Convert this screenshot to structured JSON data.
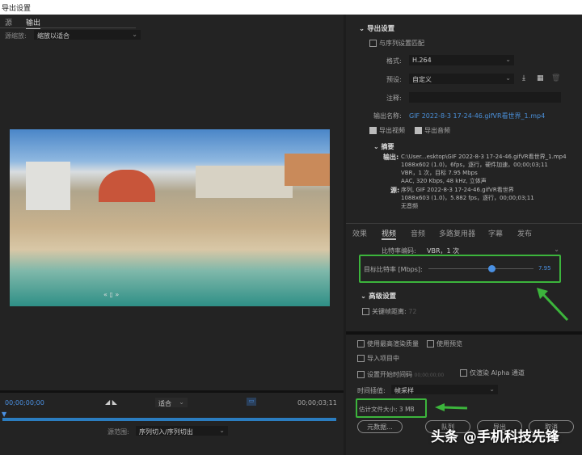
{
  "window": {
    "title": "导出设置"
  },
  "left": {
    "tabs": [
      {
        "label": "源"
      },
      {
        "label": "输出"
      }
    ],
    "source_scale_label": "源缩放:",
    "source_scale_value": "缩放以适合",
    "timecode_start": "00;00;00;00",
    "timecode_end": "00;00;03;11",
    "fit_value": "适合",
    "source_range_label": "源范围:",
    "source_range_value": "序列切入/序列切出",
    "carousel_nav": "«  ▯  »"
  },
  "export_settings": {
    "section_title": "导出设置",
    "match_sequence": "与序列设置匹配",
    "format_label": "格式:",
    "format_value": "H.264",
    "preset_label": "预设:",
    "preset_value": "自定义",
    "comment_label": "注释:",
    "comment_value": "",
    "output_name_label": "输出名称:",
    "output_name_value": "GIF 2022-8-3 17-24-46.gifVR看世界_1.mp4",
    "export_video": "导出视频",
    "export_audio": "导出音频",
    "summary_title": "摘要",
    "output_label": "输出:",
    "output_lines": [
      "C:\\User...esktop\\GIF 2022-8-3 17-24-46.gifVR看世界_1.mp4",
      "1088x602 (1.0)，6fps，逐行，硬件加速，00;00;03;11",
      "VBR，1 次，目标 7.95 Mbps",
      "AAC, 320 Kbps, 48 kHz, 立体声"
    ],
    "source_label": "源:",
    "source_lines": [
      "序列, GIF 2022-8-3 17-24-46.gifVR看世界",
      "1088x603 (1.0)，5.882 fps，逐行，00;00;03;11",
      "无音频"
    ]
  },
  "settings_tabs": [
    {
      "label": "效果"
    },
    {
      "label": "视频"
    },
    {
      "label": "音频"
    },
    {
      "label": "多路复用器"
    },
    {
      "label": "字幕"
    },
    {
      "label": "发布"
    }
  ],
  "video": {
    "bitrate_encoding_label": "比特率编码:",
    "bitrate_encoding_value": "VBR，1 次",
    "target_bitrate_label": "目标比特率 [Mbps]:",
    "target_bitrate_value": "7.95",
    "target_bitrate_fraction": 0.6,
    "advanced_title": "高级设置",
    "keyframe_label": "关键帧距离:",
    "keyframe_value": "72"
  },
  "bottom": {
    "max_render_quality": "使用最高渲染质量",
    "use_previews": "使用预览",
    "import_into_project": "导入项目中",
    "set_start_timecode": "设置开始时间码",
    "start_timecode_value": "00;00;00;00",
    "render_alpha_only": "仅渲染 Alpha 通道",
    "time_interpolation_label": "时间插值:",
    "time_interpolation_value": "帧采样",
    "estimated_size": "估计文件大小: 3 MB",
    "buttons": {
      "metadata": "元数据...",
      "queue": "队列",
      "export": "导出",
      "cancel": "取消"
    }
  },
  "watermark": "头条 @手机科技先锋",
  "colors": {
    "accent": "#4a90e2",
    "highlight": "#3cb53c",
    "link": "#4a8fd8"
  }
}
